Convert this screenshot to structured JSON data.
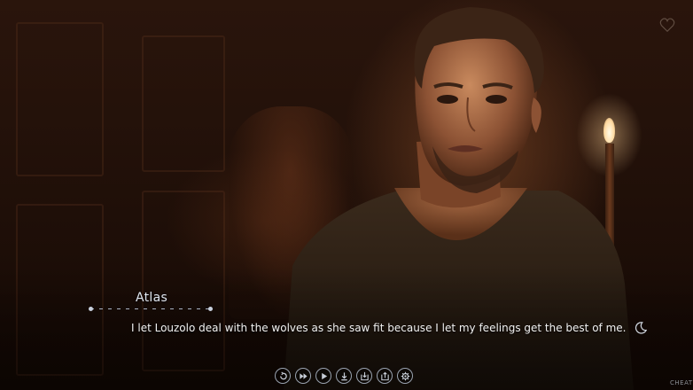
{
  "speaker": {
    "name": "Atlas"
  },
  "dialogue": {
    "text": "I let Louzolo deal with the wolves as she saw fit because I let my feelings get the best of me."
  },
  "quick_menu": {
    "buttons": [
      "back-icon",
      "skip-icon",
      "auto-icon",
      "download-icon",
      "save-icon",
      "load-icon",
      "settings-icon"
    ]
  },
  "corner": {
    "label": "CHEAT"
  },
  "colors": {
    "text": "#f2f2f2",
    "name": "#dfe6f0",
    "ui_outline": "#9aa3b0"
  }
}
